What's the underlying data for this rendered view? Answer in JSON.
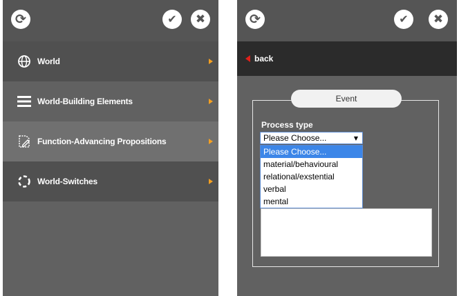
{
  "left_panel": {
    "toolbar": {
      "refresh_icon": "refresh-icon",
      "check_icon": "check-icon",
      "close_icon": "close-icon"
    },
    "menu": [
      {
        "label": "World",
        "icon": "globe-icon",
        "bg": "#505050"
      },
      {
        "label": "World-Building Elements",
        "icon": "list-icon",
        "bg": "#616161"
      },
      {
        "label": "Function-Advancing Propositions",
        "icon": "edit-document-icon",
        "bg": "#707070"
      },
      {
        "label": "World-Switches",
        "icon": "cycle-icon",
        "bg": "#505050"
      }
    ],
    "arrow_color": "#f5a020"
  },
  "right_panel": {
    "back_label": "back",
    "back_arrow_color": "#e0201a",
    "event_label": "Event",
    "process_type_label": "Process type",
    "select": {
      "value": "Please Choose...",
      "options": [
        "Please Choose...",
        "material/behavioural",
        "relational/exstential",
        "verbal",
        "mental"
      ]
    }
  }
}
